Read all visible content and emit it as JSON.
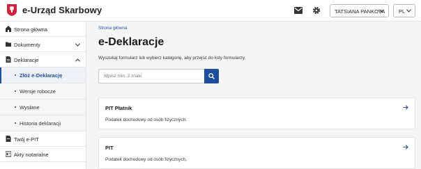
{
  "header": {
    "brand": "e-Urząd Skarbowy",
    "user": "TATSIANA PANKOVA",
    "lang": "PL"
  },
  "sidebar": {
    "items": [
      {
        "label": "Strona główna",
        "icon": "home-icon"
      },
      {
        "label": "Dokumenty",
        "icon": "folder-icon"
      },
      {
        "label": "Deklaracje",
        "icon": "document-icon"
      },
      {
        "label": "Twój e-PIT",
        "icon": "document-icon"
      },
      {
        "label": "Akty notarialne",
        "icon": "notary-icon"
      }
    ],
    "subitems": [
      {
        "label": "Złóż e-Deklarację",
        "active": true
      },
      {
        "label": "Wersje robocze"
      },
      {
        "label": "Wysłane"
      },
      {
        "label": "Historia deklaracji"
      }
    ]
  },
  "main": {
    "breadcrumb": "Strona główna",
    "title": "e-Deklaracje",
    "description": "Wyszukaj formularz lub wybierz kategorię, aby przejść do listy formularzy.",
    "search_placeholder": "Wpisz min. 3 znaki",
    "cards": [
      {
        "title": "PIT Płatnik",
        "subtitle": "Podatek dochodowy od osób fizycznych."
      },
      {
        "title": "PIT",
        "subtitle": "Podatek dochodowy od osób fizycznych."
      }
    ]
  },
  "colors": {
    "accent": "#1d4e9e",
    "emblem_red": "#d4213d"
  }
}
